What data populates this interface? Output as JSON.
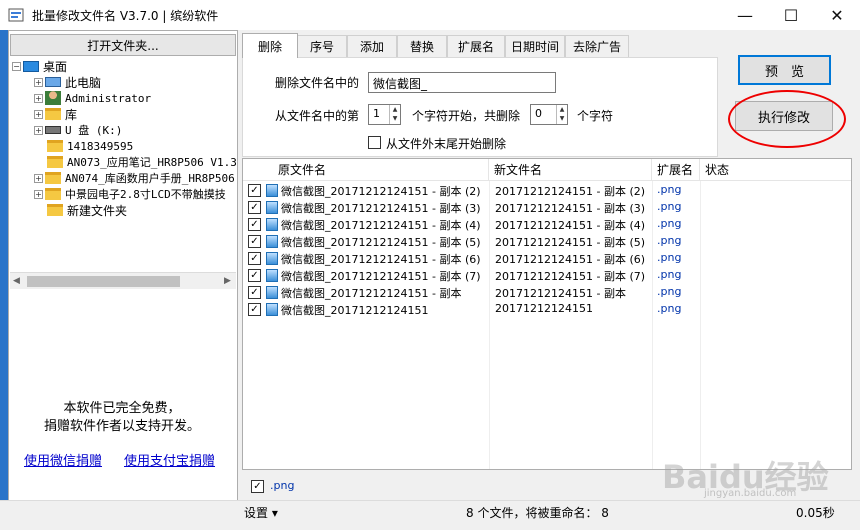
{
  "window": {
    "title": "批量修改文件名 V3.7.0 | 缤纷软件",
    "minimize": "—",
    "maximize": "☐",
    "close": "✕"
  },
  "left": {
    "open_folder": "打开文件夹...",
    "tree": [
      {
        "label": "桌面",
        "expander": "−",
        "icon": "desktop-icon",
        "indent": 0
      },
      {
        "label": "此电脑",
        "expander": "+",
        "icon": "computer-icon",
        "indent": 1
      },
      {
        "label": "Administrator",
        "expander": "+",
        "icon": "user-icon",
        "indent": 1
      },
      {
        "label": "库",
        "expander": "+",
        "icon": "library-icon",
        "indent": 1
      },
      {
        "label": "U 盘 (K:)",
        "expander": "+",
        "icon": "usb-drive-icon",
        "indent": 1
      },
      {
        "label": "1418349595",
        "expander": "",
        "icon": "folder-icon",
        "indent": 1
      },
      {
        "label": "AN073_应用笔记_HR8P506 V1.3",
        "expander": "",
        "icon": "folder-icon",
        "indent": 1
      },
      {
        "label": "AN074_库函数用户手册_HR8P506",
        "expander": "+",
        "icon": "folder-icon",
        "indent": 1
      },
      {
        "label": "中景园电子2.8寸LCD不带触摸技",
        "expander": "+",
        "icon": "folder-icon",
        "indent": 1
      },
      {
        "label": "新建文件夹",
        "expander": "",
        "icon": "folder-icon",
        "indent": 1
      }
    ],
    "free_text_1": "本软件已完全免费，",
    "free_text_2": "捐赠软件作者以支持开发。",
    "donate_wechat": "使用微信捐赠",
    "donate_alipay": "使用支付宝捐赠"
  },
  "tabs": [
    "删除",
    "序号",
    "添加",
    "替换",
    "扩展名",
    "日期时间",
    "去除广告"
  ],
  "delete_panel": {
    "label_delete": "删除文件名中的",
    "delete_value": "微信截图_",
    "label_from": "从文件名中的第",
    "start_value": "1",
    "label_start": "个字符开始，共删除",
    "count_value": "0",
    "label_chars": "个字符",
    "label_tail": "从文件外末尾开始删除"
  },
  "buttons": {
    "preview": "预　览",
    "execute": "执行修改"
  },
  "list": {
    "columns": [
      "原文件名",
      "新文件名",
      "扩展名",
      "状态"
    ],
    "rows": [
      {
        "orig": "微信截图_20171212124151 - 副本 (2)",
        "new": "20171212124151 - 副本 (2)",
        "ext": ".png",
        "status": ""
      },
      {
        "orig": "微信截图_20171212124151 - 副本 (3)",
        "new": "20171212124151 - 副本 (3)",
        "ext": ".png",
        "status": ""
      },
      {
        "orig": "微信截图_20171212124151 - 副本 (4)",
        "new": "20171212124151 - 副本 (4)",
        "ext": ".png",
        "status": ""
      },
      {
        "orig": "微信截图_20171212124151 - 副本 (5)",
        "new": "20171212124151 - 副本 (5)",
        "ext": ".png",
        "status": ""
      },
      {
        "orig": "微信截图_20171212124151 - 副本 (6)",
        "new": "20171212124151 - 副本 (6)",
        "ext": ".png",
        "status": ""
      },
      {
        "orig": "微信截图_20171212124151 - 副本 (7)",
        "new": "20171212124151 - 副本 (7)",
        "ext": ".png",
        "status": ""
      },
      {
        "orig": "微信截图_20171212124151 - 副本",
        "new": "20171212124151 - 副本",
        "ext": ".png",
        "status": ""
      },
      {
        "orig": "微信截图_20171212124151",
        "new": "20171212124151",
        "ext": ".png",
        "status": ""
      }
    ]
  },
  "filter": {
    "ext": ".png"
  },
  "status": {
    "settings": "设置 ▾",
    "count": "8 个文件，将被重命名： 8",
    "time": "0.05秒"
  },
  "watermark": {
    "main": "Baidu经验",
    "sub": "jingyan.baidu.com"
  }
}
